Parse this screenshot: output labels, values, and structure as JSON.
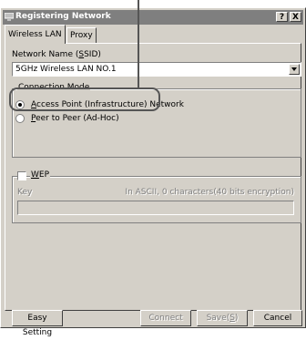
{
  "window": {
    "title": "Registering Network",
    "help_btn": "?",
    "close_btn": "X"
  },
  "tabs": [
    {
      "label": "Wireless LAN",
      "active": true
    },
    {
      "label": "Proxy",
      "active": false
    }
  ],
  "network_name": {
    "label_pre": "Network Name (",
    "label_key": "S",
    "label_post": "SID)",
    "value": "5GHz Wireless LAN NO.1"
  },
  "connection_mode": {
    "legend": "Connection Mode",
    "options": [
      {
        "key": "A",
        "rest": "ccess Point (Infrastructure) Network",
        "selected": true
      },
      {
        "key": "P",
        "rest": "eer to Peer (Ad-Hoc)",
        "selected": false
      }
    ]
  },
  "wep": {
    "key_letter": "W",
    "rest": "EP",
    "checked": false,
    "key_label": "Key",
    "key_hint": "In ASCII, 0 characters(40 bits encryption)",
    "key_value": ""
  },
  "buttons": {
    "easy_setting": "Easy Setting",
    "connect": "Connect",
    "save_pre": "Save",
    "save_key": "S",
    "cancel": "Cancel"
  },
  "colors": {
    "dialog_bg": "#d4d0c8",
    "titlebar_inactive": "#7f7f7f",
    "annotation": "#555555"
  }
}
